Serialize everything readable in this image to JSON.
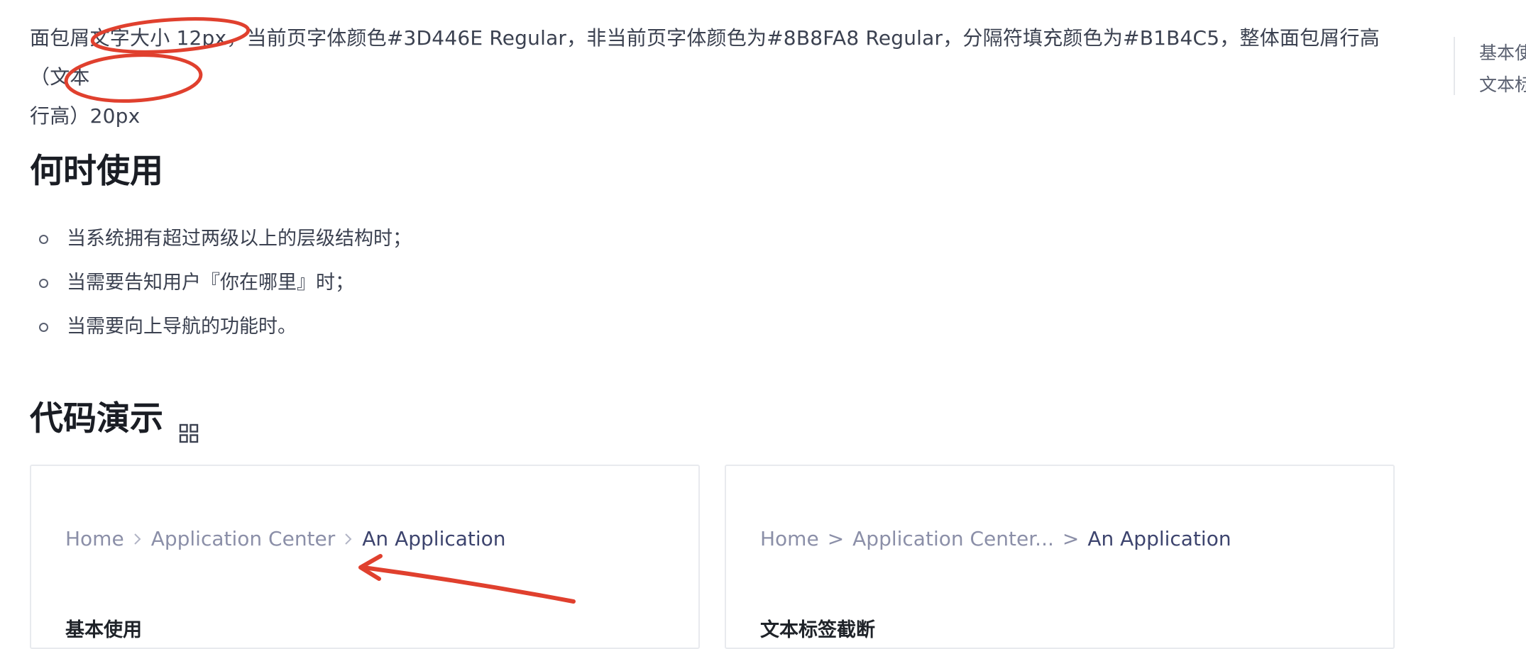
{
  "intro": {
    "line1": "面包屑文字大小 12px，当前页字体颜色#3D446E Regular，非当前页字体颜色为#8B8FA8 Regular，分隔符填充颜色为#B1B4C5，整体面包屑行高（文本",
    "line2": "行高）20px"
  },
  "toc": {
    "items": [
      "基本使用",
      "文本标签截断"
    ]
  },
  "when_section": {
    "title": "何时使用",
    "bullets": [
      "当系统拥有超过两级以上的层级结构时；",
      "当需要告知用户『你在哪里』时；",
      "当需要向上导航的功能时。"
    ]
  },
  "demo_section": {
    "title": "代码演示",
    "toggle_icon": "grid-icon"
  },
  "cards": [
    {
      "crumbs": [
        "Home",
        "Application Center",
        "An Application"
      ],
      "separator_icon": "chevron-right-icon",
      "caption": "基本使用"
    },
    {
      "crumbs": [
        "Home",
        "Application Center...",
        "An Application"
      ],
      "separator_text": ">",
      "caption": "文本标签截断"
    }
  ],
  "colors": {
    "current_crumb": "#3D446E",
    "other_crumb": "#8B8FA8",
    "separator": "#B1B4C5",
    "annotation": "#E0402E"
  }
}
